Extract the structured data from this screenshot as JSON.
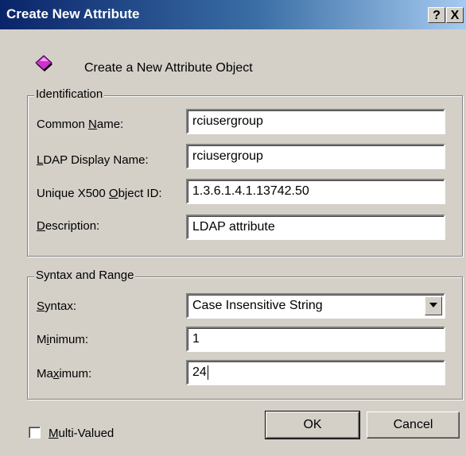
{
  "window": {
    "title": "Create New Attribute",
    "help_label": "?",
    "close_label": "X"
  },
  "header": {
    "icon": "attribute-object-icon",
    "text": "Create a New Attribute Object"
  },
  "identification": {
    "legend": "Identification",
    "common_name": {
      "label_pre": "Common ",
      "label_u": "N",
      "label_post": "ame:",
      "value": "rciusergroup"
    },
    "ldap_name": {
      "label_pre": "",
      "label_u": "L",
      "label_post": "DAP Display Name:",
      "value": "rciusergroup"
    },
    "x500_oid": {
      "label_pre": "Unique X500 ",
      "label_u": "O",
      "label_post": "bject ID:",
      "value": "1.3.6.1.4.1.13742.50"
    },
    "description": {
      "label_pre": "",
      "label_u": "D",
      "label_post": "escription:",
      "value": "LDAP attribute"
    }
  },
  "syntax_range": {
    "legend": "Syntax and Range",
    "syntax": {
      "label_pre": "",
      "label_u": "S",
      "label_post": "yntax:",
      "value": "Case Insensitive String"
    },
    "minimum": {
      "label_pre": "M",
      "label_u": "i",
      "label_post": "nimum:",
      "value": "1"
    },
    "maximum": {
      "label_pre": "Ma",
      "label_u": "x",
      "label_post": "imum:",
      "value": "24"
    }
  },
  "multi_valued": {
    "label_pre": "",
    "label_u": "M",
    "label_post": "ulti-Valued",
    "checked": false
  },
  "buttons": {
    "ok": "OK",
    "cancel": "Cancel"
  },
  "colors": {
    "icon_fill": "#cc33cc",
    "titlebar": "#0a246a"
  }
}
